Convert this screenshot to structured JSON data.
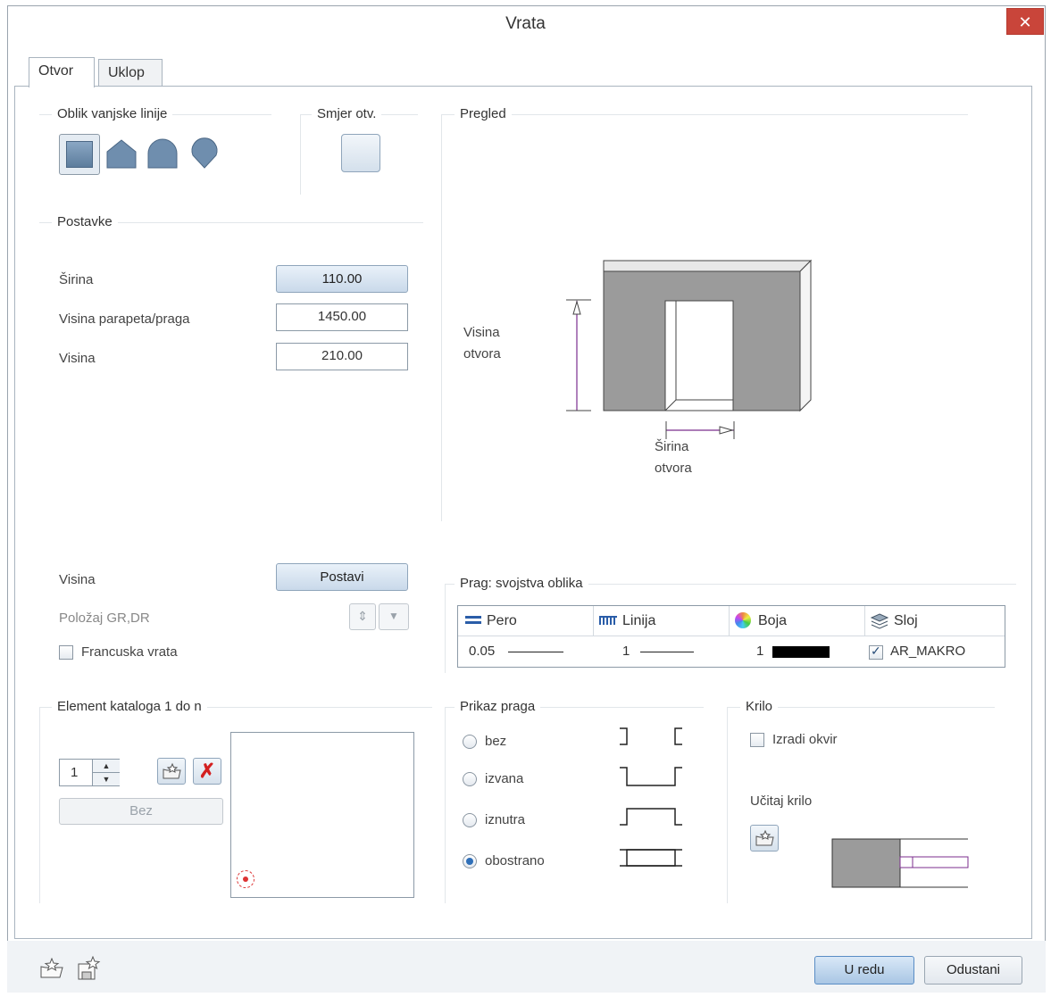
{
  "window": {
    "title": "Vrata",
    "close_glyph": "✕"
  },
  "tabs": [
    {
      "label": "Otvor"
    },
    {
      "label": "Uklop"
    }
  ],
  "outline": {
    "group_label": "Oblik vanjske linije",
    "shapes": [
      "rectangle-shape-icon",
      "gable-shape-icon",
      "arch-shape-icon",
      "round-shape-icon"
    ]
  },
  "direction": {
    "group_label": "Smjer otv."
  },
  "preview": {
    "group_label": "Pregled",
    "height_label_1": "Visina",
    "height_label_2": "otvora",
    "width_label_1": "Širina",
    "width_label_2": "otvora"
  },
  "settings": {
    "group_label": "Postavke",
    "width_label": "Širina",
    "width_value": "110.00",
    "parapet_label": "Visina parapeta/praga",
    "parapet_value": "1450.00",
    "height_label": "Visina",
    "height_value": "210.00",
    "visina_label": "Visina",
    "postavi_label": "Postavi",
    "position_label": "Položaj GR,DR",
    "french_label": "Francuska vrata"
  },
  "threshold_props": {
    "group_label": "Prag: svojstva oblika",
    "headers": [
      "Pero",
      "Linija",
      "Boja",
      "Sloj"
    ],
    "pen_value": "0.05",
    "line_value": "1",
    "color_value": "1",
    "layer_value": "AR_MAKRO",
    "color_swatch": "#000000"
  },
  "catalog": {
    "group_label": "Element kataloga 1 do n",
    "count_value": "1",
    "bez_label": "Bez"
  },
  "threshold_display": {
    "group_label": "Prikaz praga",
    "options": [
      {
        "label": "bez",
        "selected": false
      },
      {
        "label": "izvana",
        "selected": false
      },
      {
        "label": "iznutra",
        "selected": false
      },
      {
        "label": "obostrano",
        "selected": true
      }
    ]
  },
  "leaf": {
    "group_label": "Krilo",
    "frame_label": "Izradi okvir",
    "load_label": "Učitaj krilo"
  },
  "footer": {
    "ok_label": "U redu",
    "cancel_label": "Odustani"
  },
  "colors": {
    "accent": "#c9453a",
    "wall": "#9b9b9b",
    "dimension": "#7b2d8e"
  }
}
